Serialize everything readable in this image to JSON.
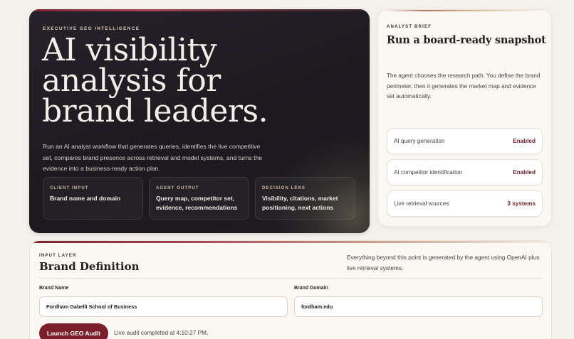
{
  "hero": {
    "eyebrow": "EXECUTIVE GEO INTELLIGENCE",
    "title_lines": [
      "AI visibility",
      "analysis for",
      "brand leaders."
    ],
    "lead": "Run an AI analyst workflow that generates queries, identifies the live competitive set, compares brand presence across retrieval and model systems, and turns the evidence into a business-ready action plan.",
    "cards": [
      {
        "label": "CLIENT INPUT",
        "value": "Brand name and domain"
      },
      {
        "label": "AGENT OUTPUT",
        "value": "Query map, competitor set, evidence, recommendations"
      },
      {
        "label": "DECISION LENS",
        "value": "Visibility, citations, market positioning, next actions"
      }
    ]
  },
  "brief": {
    "eyebrow": "ANALYST BRIEF",
    "title": "Run a board-ready snapshot",
    "description": "The agent chooses the research path. You define the brand perimeter, then it generates the market map and evidence set automatically.",
    "stats": [
      {
        "label": "AI query generation",
        "value": "Enabled"
      },
      {
        "label": "AI competitor identification",
        "value": "Enabled"
      },
      {
        "label": "Live retrieval sources",
        "value": "3 systems"
      }
    ]
  },
  "input_layer": {
    "eyebrow": "INPUT LAYER",
    "title": "Brand Definition",
    "note": "Everything beyond this point is generated by the agent using OpenAI plus live retrieval systems.",
    "brand_name_label": "Brand Name",
    "brand_name_value": "Fordham Gabelli School of Business",
    "brand_domain_label": "Brand Domain",
    "brand_domain_value": "fordham.edu",
    "launch_label": "Launch GEO Audit",
    "status": "Live audit completed at 4:10:27 PM."
  },
  "colors": {
    "accent": "#7a1f2b",
    "hero_bg": "#1c1a1f",
    "page_bg": "#f4f1ec"
  }
}
